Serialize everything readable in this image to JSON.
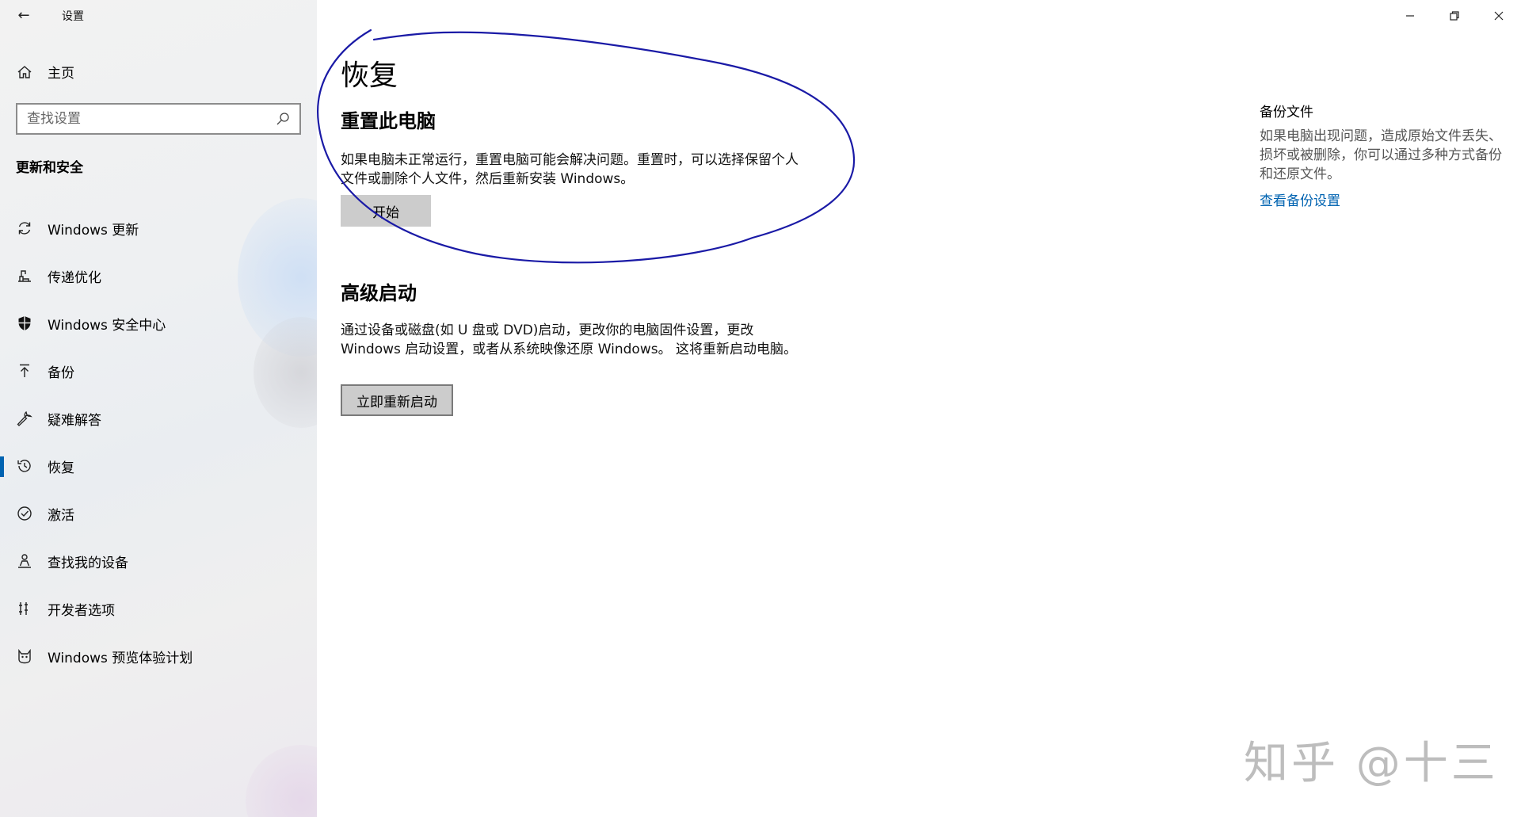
{
  "window": {
    "title": "设置",
    "controls": [
      "minimize-icon",
      "restore-icon",
      "close-icon"
    ]
  },
  "sidebar": {
    "home_label": "主页",
    "search_placeholder": "查找设置",
    "section_title": "更新和安全",
    "items": [
      {
        "label": "Windows 更新",
        "icon": "refresh-icon",
        "active": false
      },
      {
        "label": "传递优化",
        "icon": "delivery-icon",
        "active": false
      },
      {
        "label": "Windows 安全中心",
        "icon": "shield-icon",
        "active": false
      },
      {
        "label": "备份",
        "icon": "backup-arrow-icon",
        "active": false
      },
      {
        "label": "疑难解答",
        "icon": "wrench-icon",
        "active": false
      },
      {
        "label": "恢复",
        "icon": "history-icon",
        "active": true
      },
      {
        "label": "激活",
        "icon": "check-circle-icon",
        "active": false
      },
      {
        "label": "查找我的设备",
        "icon": "person-pin-icon",
        "active": false
      },
      {
        "label": "开发者选项",
        "icon": "developer-icon",
        "active": false
      },
      {
        "label": "Windows 预览体验计划",
        "icon": "insider-cat-icon",
        "active": false
      }
    ]
  },
  "main": {
    "title": "恢复",
    "reset": {
      "heading": "重置此电脑",
      "description": "如果电脑未正常运行，重置电脑可能会解决问题。重置时，可以选择保留个人文件或删除个人文件，然后重新安装 Windows。",
      "button": "开始"
    },
    "advanced": {
      "heading": "高级启动",
      "description": "通过设备或磁盘(如 U 盘或 DVD)启动，更改你的电脑固件设置，更改 Windows 启动设置，或者从系统映像还原 Windows。 这将重新启动电脑。",
      "button": "立即重新启动"
    }
  },
  "aside": {
    "title": "备份文件",
    "description": "如果电脑出现问题，造成原始文件丢失、损坏或被删除，你可以通过多种方式备份和还原文件。",
    "link": "查看备份设置"
  },
  "watermark": "知乎 @十三",
  "colors": {
    "accent": "#0063b1",
    "annotation": "#1a1aa6",
    "button": "#cccccc"
  }
}
